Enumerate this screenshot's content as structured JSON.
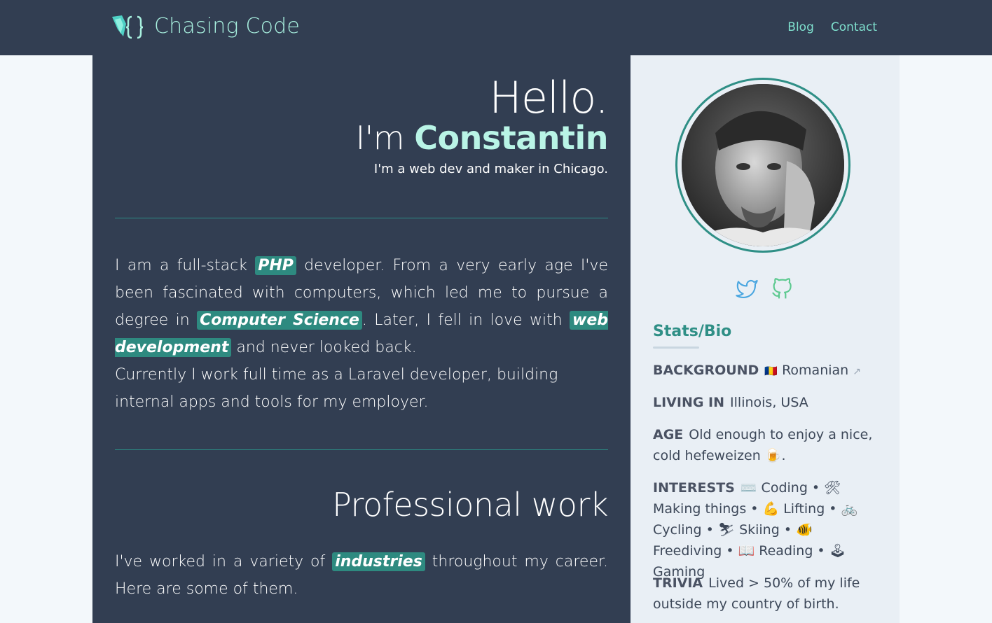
{
  "header": {
    "brand": "Chasing Code",
    "nav": [
      "Blog",
      "Contact"
    ]
  },
  "hero": {
    "hello": "Hello.",
    "im_prefix": "I'm ",
    "name": "Constantin",
    "tagline": "I'm a web dev and maker in Chicago."
  },
  "about": {
    "p1_a": "I am a full-stack ",
    "p1_hl1": "PHP",
    "p1_b": " developer. From a very early age I've been fascinated with computers, which led me to pursue a degree in ",
    "p1_hl2": "Computer Science",
    "p1_c": ". Later, I fell in love with ",
    "p1_hl3": "web development",
    "p1_d": " and never looked back.",
    "p2": "Currently I work full time as a Laravel developer, building internal apps and tools for my employer."
  },
  "work": {
    "heading": "Professional work",
    "p_a": "I've worked in a variety of ",
    "p_hl": "industries",
    "p_b": " throughout my career. Here are some of them."
  },
  "sidebar": {
    "social_icons": [
      "twitter-icon",
      "github-icon"
    ],
    "stats_heading": "Stats/Bio",
    "background_label": "BACKGROUND",
    "background_flag": "🇷🇴",
    "background_value": "Romanian",
    "living_label": "LIVING IN",
    "living_value": "Illinois, USA",
    "age_label": "AGE",
    "age_value": "Old enough to enjoy a nice, cold hefeweizen 🍺.",
    "interests_label": "INTERESTS",
    "interests_value": "⌨️ Coding • 🛠 Making things • 💪 Lifting • 🚲 Cycling • ⛷ Skiing • 🐠 Freediving • 📖 Reading • 🕹 Gaming",
    "trivia_label": "TRIVIA",
    "trivia_value": "Lived > 50% of my life outside my country of birth."
  },
  "colors": {
    "nav_bg": "#323e52",
    "accent": "#2f8f86",
    "name": "#b9f4e6",
    "link": "#7fe0ce",
    "sidebar_bg": "#e9eff5"
  }
}
